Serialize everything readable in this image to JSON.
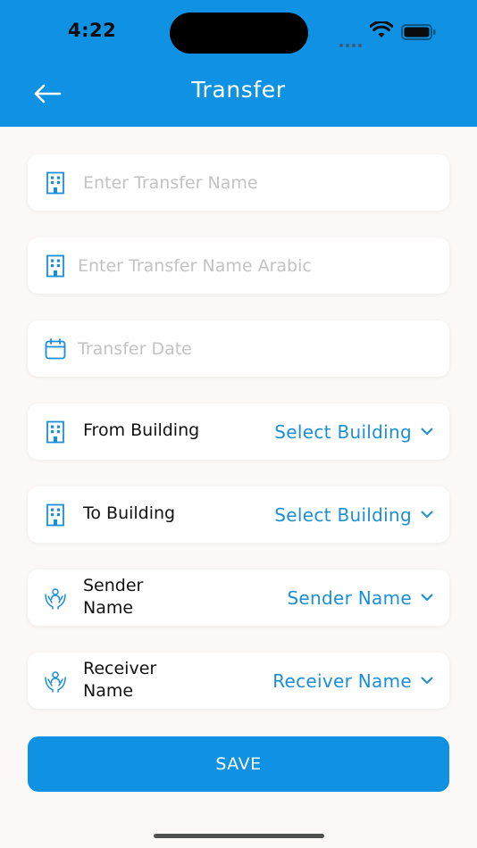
{
  "status_bar": {
    "time": "4:22"
  },
  "header": {
    "title": "Transfer"
  },
  "fields": {
    "transfer_name": {
      "placeholder": "Enter Transfer Name",
      "value": ""
    },
    "transfer_name_arabic": {
      "placeholder": "Enter Transfer Name Arabic",
      "value": ""
    },
    "transfer_date": {
      "placeholder": "Transfer Date",
      "value": ""
    }
  },
  "selects": {
    "from_building": {
      "label": "From Building",
      "value": "Select Building"
    },
    "to_building": {
      "label": "To Building",
      "value": "Select Building"
    },
    "sender": {
      "label_line1": "Sender",
      "label_line2": "Name",
      "value": "Sender Name"
    },
    "receiver": {
      "label_line1": "Receiver",
      "label_line2": "Name",
      "value": "Receiver Name"
    }
  },
  "actions": {
    "save_label": "SAVE"
  },
  "colors": {
    "primary": "#0f92e3",
    "accent_text": "#1a8fd8",
    "background": "#fcf8f7"
  },
  "icons": {
    "back": "arrow-left-icon",
    "building": "building-icon",
    "calendar": "calendar-icon",
    "person": "hands-person-icon",
    "chevron": "chevron-down-icon"
  }
}
